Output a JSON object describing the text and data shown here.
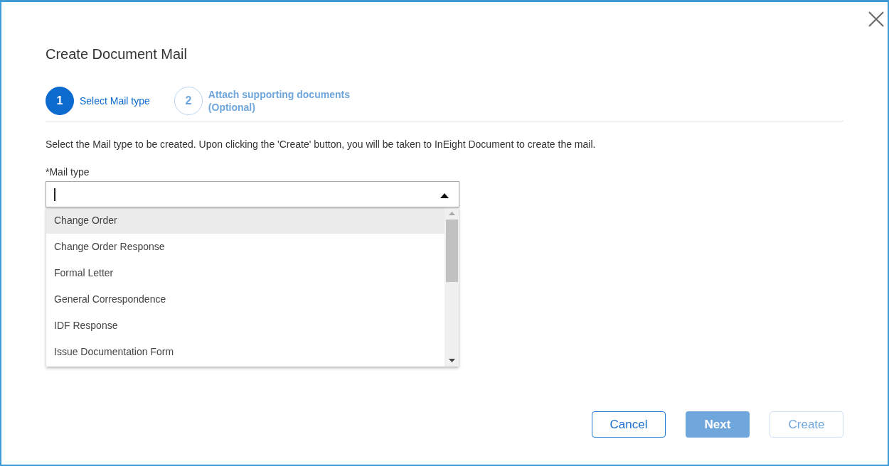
{
  "dialog": {
    "title": "Create Document Mail"
  },
  "steps": [
    {
      "number": "1",
      "label": "Select Mail type",
      "selected": true
    },
    {
      "number": "2",
      "label": "Attach supporting documents",
      "sublabel": "(Optional)",
      "selected": false
    }
  ],
  "instruction": "Select the Mail type to be created. Upon clicking the 'Create' button, you will be taken to InEight Document to create the mail.",
  "mail_type": {
    "label": "*Mail type",
    "expanded": true,
    "options": [
      {
        "label": "Change Order",
        "selected": true
      },
      {
        "label": "Change Order Response",
        "selected": false
      },
      {
        "label": "Formal Letter",
        "selected": false
      },
      {
        "label": "General Correspondence",
        "selected": false
      },
      {
        "label": "IDF Response",
        "selected": false
      },
      {
        "label": "Issue Documentation Form",
        "selected": false
      }
    ]
  },
  "buttons": [
    {
      "label": "Cancel",
      "kind": "outline",
      "disabled": false
    },
    {
      "label": "Next",
      "kind": "primary",
      "disabled": true
    },
    {
      "label": "Create",
      "kind": "outline",
      "disabled": true
    }
  ]
}
